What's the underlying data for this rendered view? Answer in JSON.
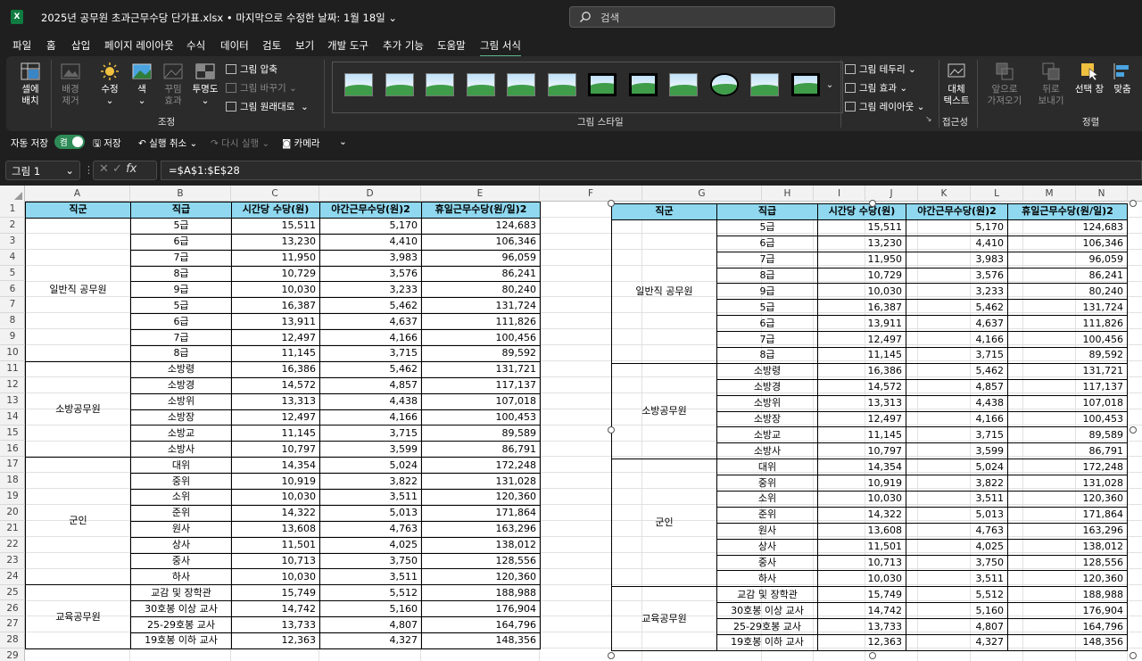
{
  "title_bar": {
    "app_icon": "excel-icon",
    "document_title": "2025년 공무원 초과근무수당 단가표.xlsx • 마지막으로 수정한 날짜: 1월 18일 ⌄",
    "search_placeholder": "검색"
  },
  "menu_tabs": [
    {
      "label": "파일",
      "active": false
    },
    {
      "label": "홈",
      "active": false
    },
    {
      "label": "삽입",
      "active": false
    },
    {
      "label": "페이지 레이아웃",
      "active": false
    },
    {
      "label": "수식",
      "active": false
    },
    {
      "label": "데이터",
      "active": false
    },
    {
      "label": "검토",
      "active": false
    },
    {
      "label": "보기",
      "active": false
    },
    {
      "label": "개발 도구",
      "active": false
    },
    {
      "label": "추가 기능",
      "active": false
    },
    {
      "label": "도움말",
      "active": false
    },
    {
      "label": "그림 서식",
      "active": true
    }
  ],
  "ribbon": {
    "cell_placement": [
      "셀에",
      "배치"
    ],
    "remove_bg": [
      "배경",
      "제거"
    ],
    "corrections": "수정",
    "color": "색",
    "artistic": [
      "꾸밈",
      "효과"
    ],
    "transparency": "투명도",
    "compress": "그림 압축",
    "change_picture": "그림 바꾸기",
    "reset_picture": "그림 원래대로",
    "adjust_group": "조정",
    "styles_group": "그림 스타일",
    "border": "그림 테두리",
    "effects": "그림 효과",
    "layout": "그림 레이아웃",
    "alt_text": [
      "대체",
      "텍스트"
    ],
    "accessibility_group": "접근성",
    "bring_forward": [
      "앞으로",
      "가져오기"
    ],
    "send_backward": [
      "뒤로",
      "보내기"
    ],
    "selection_pane": "선택 창",
    "align": "맞춤",
    "arrange_group": "정렬"
  },
  "qat": {
    "autosave_label": "자동 저장",
    "autosave_state": "켬",
    "save": "저장",
    "undo": "실행 취소",
    "redo": "다시 실행",
    "camera": "카메라"
  },
  "formula_bar": {
    "name_box": "그림 1",
    "formula": "=$A$1:$E$28"
  },
  "columns": [
    "A",
    "B",
    "C",
    "D",
    "E",
    "F",
    "G",
    "H",
    "I",
    "J",
    "K",
    "L",
    "M",
    "N"
  ],
  "rows": [
    "1",
    "2",
    "3",
    "4",
    "5",
    "6",
    "7",
    "8",
    "9",
    "10",
    "11",
    "12",
    "13",
    "14",
    "15",
    "16",
    "17",
    "18",
    "19",
    "20",
    "21",
    "22",
    "23",
    "24",
    "25",
    "26",
    "27",
    "28",
    "29"
  ],
  "table": {
    "headers": [
      "직군",
      "직급",
      "시간당 수당(원)",
      "야간근무수당(원)2",
      "휴일근무수당(원/일)2"
    ],
    "groups": [
      {
        "name": "일반직 공무원",
        "rows": [
          [
            "5급",
            "15,511",
            "5,170",
            "124,683"
          ],
          [
            "6급",
            "13,230",
            "4,410",
            "106,346"
          ],
          [
            "7급",
            "11,950",
            "3,983",
            "96,059"
          ],
          [
            "8급",
            "10,729",
            "3,576",
            "86,241"
          ],
          [
            "9급",
            "10,030",
            "3,233",
            "80,240"
          ],
          [
            "5급",
            "16,387",
            "5,462",
            "131,724"
          ],
          [
            "6급",
            "13,911",
            "4,637",
            "111,826"
          ],
          [
            "7급",
            "12,497",
            "4,166",
            "100,456"
          ],
          [
            "8급",
            "11,145",
            "3,715",
            "89,592"
          ]
        ]
      },
      {
        "name": "소방공무원",
        "rows": [
          [
            "소방령",
            "16,386",
            "5,462",
            "131,721"
          ],
          [
            "소방경",
            "14,572",
            "4,857",
            "117,137"
          ],
          [
            "소방위",
            "13,313",
            "4,438",
            "107,018"
          ],
          [
            "소방장",
            "12,497",
            "4,166",
            "100,453"
          ],
          [
            "소방교",
            "11,145",
            "3,715",
            "89,589"
          ],
          [
            "소방사",
            "10,797",
            "3,599",
            "86,791"
          ]
        ]
      },
      {
        "name": "군인",
        "rows": [
          [
            "대위",
            "14,354",
            "5,024",
            "172,248"
          ],
          [
            "중위",
            "10,919",
            "3,822",
            "131,028"
          ],
          [
            "소위",
            "10,030",
            "3,511",
            "120,360"
          ],
          [
            "준위",
            "14,322",
            "5,013",
            "171,864"
          ],
          [
            "원사",
            "13,608",
            "4,763",
            "163,296"
          ],
          [
            "상사",
            "11,501",
            "4,025",
            "138,012"
          ],
          [
            "중사",
            "10,713",
            "3,750",
            "128,556"
          ],
          [
            "하사",
            "10,030",
            "3,511",
            "120,360"
          ]
        ]
      },
      {
        "name": "교육공무원",
        "rows": [
          [
            "교감 및 장학관",
            "15,749",
            "5,512",
            "188,988"
          ],
          [
            "30호봉 이상 교사",
            "14,742",
            "5,160",
            "176,904"
          ],
          [
            "25-29호봉 교사",
            "13,733",
            "4,807",
            "164,796"
          ],
          [
            "19호봉 이하 교사",
            "12,363",
            "4,327",
            "148,356"
          ]
        ]
      }
    ]
  },
  "colors": {
    "header_fill": "#8fd8ef",
    "accent": "#5fb58a",
    "excel_green": "#107c41"
  }
}
